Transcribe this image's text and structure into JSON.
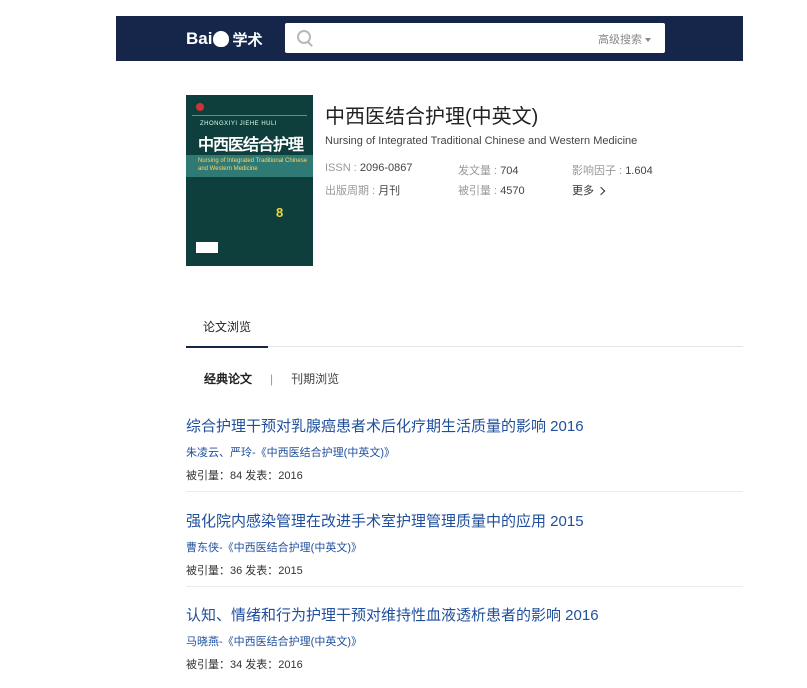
{
  "header": {
    "logo_text_1": "Bai",
    "logo_text_2": "学术",
    "search_placeholder": "",
    "advanced_search": "高级搜索"
  },
  "journal": {
    "cover": {
      "pinyin": "ZHONGXIYI JIEHE HULI",
      "title": "中西医结合护理",
      "en": "Nursing of Integrated Traditional Chinese and Western Medicine",
      "issue_number": "8"
    },
    "title_cn": "中西医结合护理(中英文)",
    "title_en": "Nursing of Integrated Traditional Chinese and Western Medicine",
    "issn_label": "ISSN :",
    "issn_value": "2096-0867",
    "papers_label": "发文量 :",
    "papers_value": "704",
    "impact_label": "影响因子 :",
    "impact_value": "1.604",
    "cycle_label": "出版周期 :",
    "cycle_value": "月刊",
    "cited_label": "被引量 :",
    "cited_value": "4570",
    "more_label": "更多"
  },
  "tabs": {
    "active": "论文浏览"
  },
  "subtabs": {
    "selected": "经典论文",
    "separator": "|",
    "other": "刊期浏览"
  },
  "papers": [
    {
      "title": "综合护理干预对乳腺癌患者术后化疗期生活质量的影响 2016",
      "authors": "朱凌云、严玲-《中西医结合护理(中英文)》",
      "meta": "被引量：84   发表：2016"
    },
    {
      "title": "强化院内感染管理在改进手术室护理管理质量中的应用 2015",
      "authors": "曹东侠-《中西医结合护理(中英文)》",
      "meta": "被引量：36   发表：2015"
    },
    {
      "title": "认知、情绪和行为护理干预对维持性血液透析患者的影响 2016",
      "authors": "马晓燕-《中西医结合护理(中英文)》",
      "meta": "被引量：34   发表：2016"
    }
  ]
}
